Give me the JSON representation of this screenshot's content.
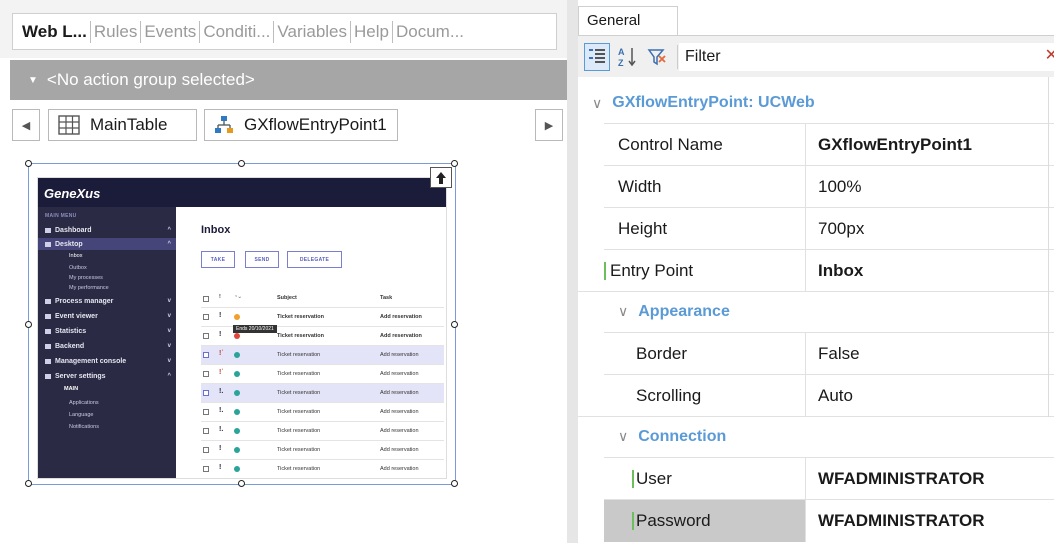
{
  "left_tabs": [
    "Web L...",
    "Rules",
    "Events",
    "Conditi...",
    "Variables",
    "Help",
    "Docum..."
  ],
  "action_bar": {
    "label": "<No action group selected>"
  },
  "breadcrumb": {
    "items": [
      "MainTable",
      "GXflowEntryPoint1"
    ]
  },
  "preview": {
    "logo": "GeneXus",
    "menu_title": "MAIN MENU",
    "menu": [
      {
        "label": "Dashboard",
        "chev": "^"
      },
      {
        "label": "Desktop",
        "chev": "^"
      },
      {
        "label": "Process manager",
        "chev": "v"
      },
      {
        "label": "Event viewer",
        "chev": "v"
      },
      {
        "label": "Statistics",
        "chev": "v"
      },
      {
        "label": "Backend",
        "chev": "v"
      },
      {
        "label": "Management console",
        "chev": "v"
      },
      {
        "label": "Server settings",
        "chev": "^"
      }
    ],
    "desktop_sub": [
      "Inbox",
      "Outbox",
      "My processes",
      "My performance"
    ],
    "server_sub": [
      "MAIN",
      "Applications",
      "Language",
      "Notifications"
    ],
    "inbox_title": "Inbox",
    "buttons": [
      "TAKE",
      "SEND",
      "DELEGATE"
    ],
    "headers": {
      "subject": "Subject",
      "task": "Task"
    },
    "tooltip": "Ends 20/10/2021",
    "rows": [
      {
        "subject": "Ticket reservation",
        "task": "Add reservation"
      },
      {
        "subject": "Ticket reservation",
        "task": "Add reservation"
      },
      {
        "subject": "Ticket reservation",
        "task": "Add reservation"
      },
      {
        "subject": "Ticket reservation",
        "task": "Add reservation"
      },
      {
        "subject": "Ticket reservation",
        "task": "Add reservation"
      },
      {
        "subject": "Ticket reservation",
        "task": "Add reservation"
      },
      {
        "subject": "Ticket reservation",
        "task": "Add reservation"
      },
      {
        "subject": "Ticket reservation",
        "task": "Add reservation"
      },
      {
        "subject": "Ticket reservation",
        "task": "Add reservation"
      }
    ]
  },
  "props": {
    "tab": "General",
    "filter_label": "Filter",
    "category_main": "GXflowEntryPoint: UCWeb",
    "rows_main": [
      {
        "name": "Control Name",
        "value": "GXflowEntryPoint1"
      },
      {
        "name": "Width",
        "value": "100%"
      },
      {
        "name": "Height",
        "value": "700px"
      },
      {
        "name": "Entry Point",
        "value": "Inbox"
      }
    ],
    "category_appearance": "Appearance",
    "rows_appearance": [
      {
        "name": "Border",
        "value": "False"
      },
      {
        "name": "Scrolling",
        "value": "Auto"
      }
    ],
    "category_connection": "Connection",
    "rows_connection": [
      {
        "name": "User",
        "value": "WFADMINISTRATOR"
      },
      {
        "name": "Password",
        "value": "WFADMINISTRATOR"
      }
    ]
  },
  "colors": {
    "accent": "#5a9ad6",
    "action_bar": "#a6a6a6",
    "mini_navy": "#1b1c3a",
    "mini_purple": "#5a5fc0"
  }
}
